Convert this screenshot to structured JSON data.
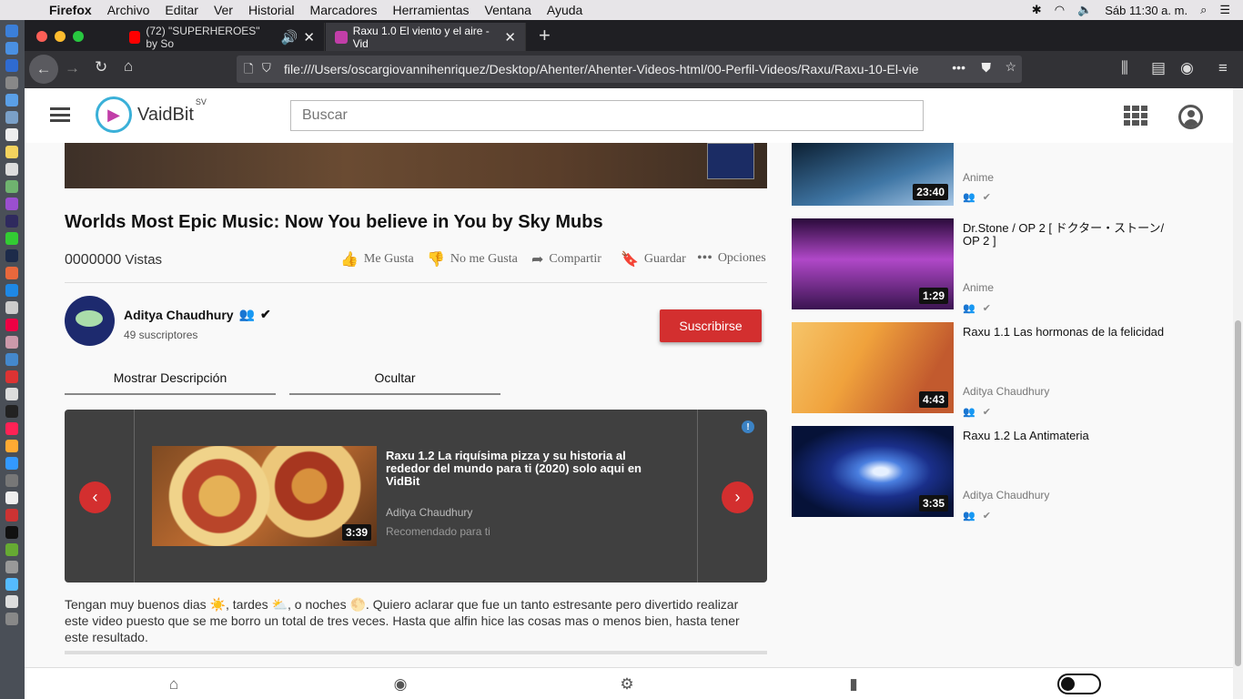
{
  "menubar": {
    "app": "Firefox",
    "items": [
      "Archivo",
      "Editar",
      "Ver",
      "Historial",
      "Marcadores",
      "Herramientas",
      "Ventana",
      "Ayuda"
    ],
    "clock": "Sáb 11:30 a. m."
  },
  "browser": {
    "tabs": [
      {
        "title": "(72) \"SUPERHEROES\" by So",
        "favicon_color": "#ff0000",
        "active": false
      },
      {
        "title": "Raxu 1.0 El viento y el aire - Vid",
        "favicon_color": "#c13ea8",
        "active": true
      }
    ],
    "url": "file:///Users/oscargiovannihenriquez/Desktop/Ahenter/Ahenter-Videos-html/00-Perfil-Videos/Raxu/Raxu-10-El-vie"
  },
  "header": {
    "logo_text": "VaidBit",
    "logo_sup": "SV",
    "search_placeholder": "Buscar"
  },
  "video": {
    "title": "Worlds Most Epic Music: Now You believe in You by Sky Mubs",
    "views_count": "0000000",
    "views_label": "Vistas",
    "actions": {
      "like": "Me Gusta",
      "dislike": "No me Gusta",
      "share": "Compartir",
      "save": "Guardar",
      "options": "Opciones"
    }
  },
  "channel": {
    "name": "Aditya Chaudhury",
    "subscribers": "49 suscriptores",
    "subscribe_label": "Suscribirse"
  },
  "description_tabs": {
    "show": "Mostrar Descripción",
    "hide": "Ocultar"
  },
  "carousel": {
    "title": "Raxu 1.2 La riquísima pizza y su historia al rededor del mundo para ti (2020) solo aqui en VidBit",
    "author": "Aditya Chaudhury",
    "note": "Recomendado para ti",
    "duration": "3:39"
  },
  "description": "Tengan muy buenos dias ☀️, tardes ⛅, o noches 🌕. Quiero aclarar que fue un tanto estresante pero divertido realizar este video puesto que se me borro un total de tres veces. Hasta que alfin hice las cosas mas o menos bien, hasta tener este resultado.",
  "sidebar": {
    "videos": [
      {
        "title": "",
        "author": "Anime",
        "duration": "23:40",
        "colors": [
          "#0a1c2e",
          "#3f76a5"
        ]
      },
      {
        "title": "Dr.Stone / OP 2 [ ドクター・ストーン/ OP 2 ]",
        "author": "Anime",
        "duration": "1:29",
        "colors": [
          "#2a0a3a",
          "#b048c8"
        ]
      },
      {
        "title": "Raxu 1.1 Las hormonas de la felicidad",
        "author": "Aditya Chaudhury",
        "duration": "4:43",
        "colors": [
          "#f0a23c",
          "#c25a2e"
        ]
      },
      {
        "title": "Raxu 1.2 La Antimateria",
        "author": "Aditya Chaudhury",
        "duration": "3:35",
        "colors": [
          "#061238",
          "#4a7fe0"
        ]
      }
    ]
  }
}
